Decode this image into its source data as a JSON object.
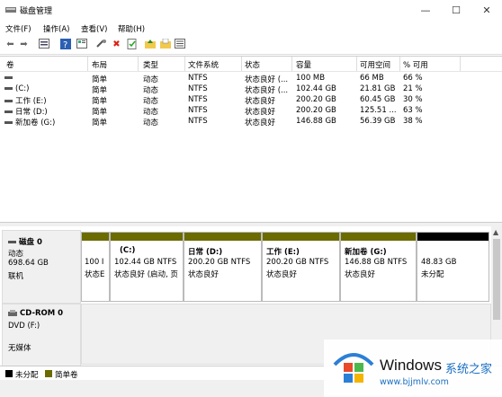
{
  "window": {
    "title": "磁盘管理",
    "min": "—",
    "max": "☐",
    "close": "✕"
  },
  "menu": [
    "文件(F)",
    "操作(A)",
    "查看(V)",
    "帮助(H)"
  ],
  "toolbar_icons": [
    "back-arrow-icon",
    "forward-arrow-icon",
    "disk-list-icon",
    "help-icon",
    "properties-icon",
    "connect-icon",
    "delete-icon",
    "check-icon",
    "folder-up-icon",
    "open-folder-icon",
    "list-view-icon"
  ],
  "columns": [
    "卷",
    "布局",
    "类型",
    "文件系统",
    "状态",
    "容量",
    "可用空间",
    "% 可用"
  ],
  "volumes": [
    {
      "name": "",
      "layout": "简单",
      "type": "动态",
      "fs": "NTFS",
      "status": "状态良好 (...",
      "cap": "100 MB",
      "free": "66 MB",
      "pct": "66 %"
    },
    {
      "name": "(C:)",
      "layout": "简单",
      "type": "动态",
      "fs": "NTFS",
      "status": "状态良好 (...",
      "cap": "102.44 GB",
      "free": "21.81 GB",
      "pct": "21 %"
    },
    {
      "name": "工作 (E:)",
      "layout": "简单",
      "type": "动态",
      "fs": "NTFS",
      "status": "状态良好",
      "cap": "200.20 GB",
      "free": "60.45 GB",
      "pct": "30 %"
    },
    {
      "name": "日常 (D:)",
      "layout": "简单",
      "type": "动态",
      "fs": "NTFS",
      "status": "状态良好",
      "cap": "200.20 GB",
      "free": "125.51 ...",
      "pct": "63 %"
    },
    {
      "name": "新加卷 (G:)",
      "layout": "简单",
      "type": "动态",
      "fs": "NTFS",
      "status": "状态良好",
      "cap": "146.88 GB",
      "free": "56.39 GB",
      "pct": "38 %"
    }
  ],
  "disk0": {
    "name": "磁盘 0",
    "type": "动态",
    "size": "698.64 GB",
    "state": "联机",
    "partitions": [
      {
        "label": "",
        "size": "100 I",
        "status": "状态E"
      },
      {
        "label": "(C:)",
        "size": "102.44 GB NTFS",
        "status": "状态良好 (启动, 页"
      },
      {
        "label": "日常  (D:)",
        "size": "200.20 GB NTFS",
        "status": "状态良好"
      },
      {
        "label": "工作  (E:)",
        "size": "200.20 GB NTFS",
        "status": "状态良好"
      },
      {
        "label": "新加卷  (G:)",
        "size": "146.88 GB NTFS",
        "status": "状态良好"
      },
      {
        "label": "",
        "size": "48.83 GB",
        "status": "未分配"
      }
    ]
  },
  "cdrom": {
    "name": "CD-ROM 0",
    "drive": "DVD (F:)",
    "media": "无媒体"
  },
  "legend": {
    "unallocated": "未分配",
    "simple": "简单卷"
  },
  "colors": {
    "simple": "#6b6b00",
    "unallocated": "#000000"
  },
  "watermark": {
    "brand": "Windows",
    "cn": "系统之家",
    "url": "www.bjjmlv.com"
  }
}
